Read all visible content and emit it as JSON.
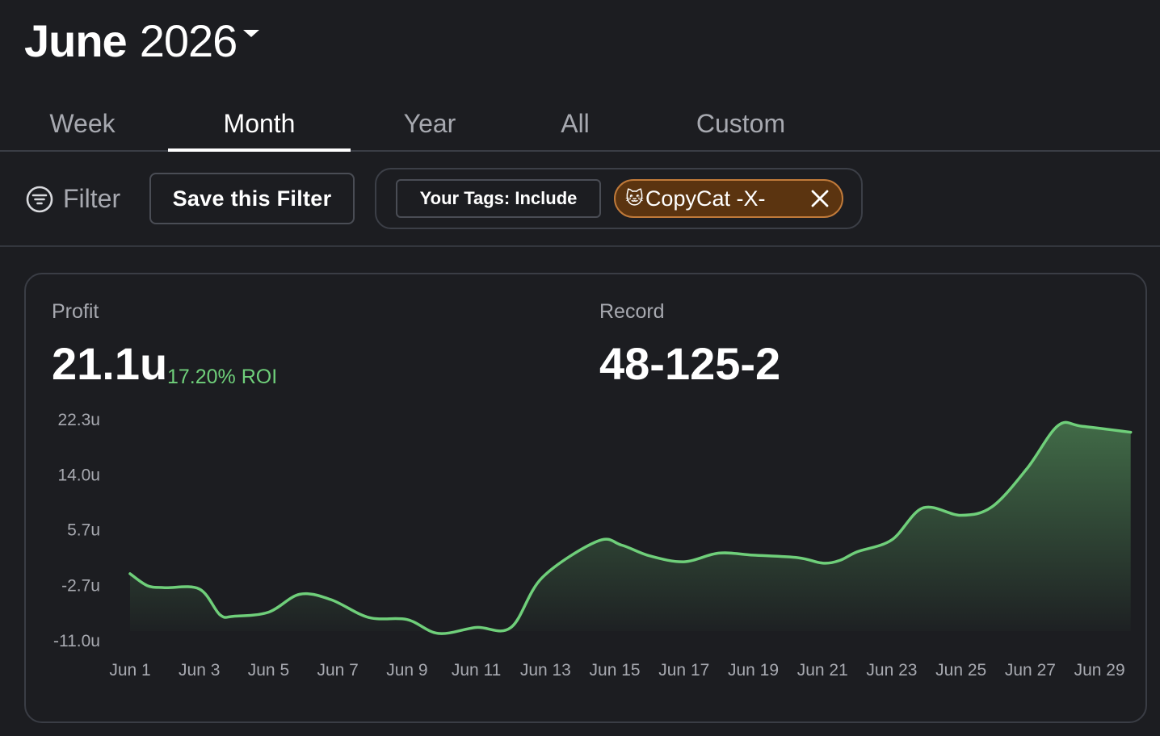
{
  "header": {
    "month": "June",
    "year": "2026"
  },
  "tabs": [
    {
      "label": "Week"
    },
    {
      "label": "Month",
      "active": true
    },
    {
      "label": "Year"
    },
    {
      "label": "All"
    },
    {
      "label": "Custom"
    }
  ],
  "filter": {
    "label": "Filter",
    "save_label": "Save this Filter",
    "tag_include_label": "Your Tags: Include",
    "tag_emoji": "🐱",
    "tag_name": "CopyCat -X-"
  },
  "stats": {
    "profit_label": "Profit",
    "profit_value": "21.1u",
    "roi": "17.20% ROI",
    "record_label": "Record",
    "record_value": "48-125-2"
  },
  "colors": {
    "line": "#6fcf7a",
    "tag_fill": "#5b3410",
    "tag_border": "#c07a3a",
    "roi": "#6fcf7a"
  },
  "chart_data": {
    "type": "area",
    "title": "",
    "xlabel": "",
    "ylabel": "",
    "ylim": [
      -11.0,
      22.3
    ],
    "yticks": [
      "22.3u",
      "14.0u",
      "5.7u",
      "-2.7u",
      "-11.0u"
    ],
    "ytick_values": [
      22.3,
      14.0,
      5.7,
      -2.7,
      -11.0
    ],
    "xtick_labels": [
      "Jun 1",
      "Jun 3",
      "Jun 5",
      "Jun 7",
      "Jun 9",
      "Jun 11",
      "Jun 13",
      "Jun 15",
      "Jun 17",
      "Jun 19",
      "Jun 21",
      "Jun 23",
      "Jun 25",
      "Jun 27",
      "Jun 29"
    ],
    "xtick_days": [
      1,
      3,
      5,
      7,
      9,
      11,
      13,
      15,
      17,
      19,
      21,
      23,
      25,
      27,
      29
    ],
    "series": [
      {
        "points": [
          [
            1,
            -0.9
          ],
          [
            1.5,
            -2.7
          ],
          [
            2,
            -3.0
          ],
          [
            3,
            -3.2
          ],
          [
            3.6,
            -7.1
          ],
          [
            4,
            -7.3
          ],
          [
            5,
            -6.7
          ],
          [
            5.9,
            -4.0
          ],
          [
            6.8,
            -4.8
          ],
          [
            7.9,
            -7.5
          ],
          [
            9.0,
            -7.8
          ],
          [
            9.9,
            -9.9
          ],
          [
            11,
            -9.0
          ],
          [
            12,
            -9.0
          ],
          [
            12.9,
            -1.5
          ],
          [
            14.5,
            4.0
          ],
          [
            15.2,
            3.4
          ],
          [
            16.0,
            1.8
          ],
          [
            17,
            0.9
          ],
          [
            18,
            2.2
          ],
          [
            19,
            1.9
          ],
          [
            20.3,
            1.5
          ],
          [
            21,
            0.7
          ],
          [
            21.5,
            1.1
          ],
          [
            22,
            2.4
          ],
          [
            23.0,
            4.2
          ],
          [
            23.9,
            9.0
          ],
          [
            25,
            7.9
          ],
          [
            25.9,
            9.2
          ],
          [
            26.9,
            14.9
          ],
          [
            27.8,
            21.4
          ],
          [
            28.5,
            21.3
          ],
          [
            29.9,
            20.4
          ]
        ]
      }
    ],
    "grid": false,
    "legend": "none"
  }
}
